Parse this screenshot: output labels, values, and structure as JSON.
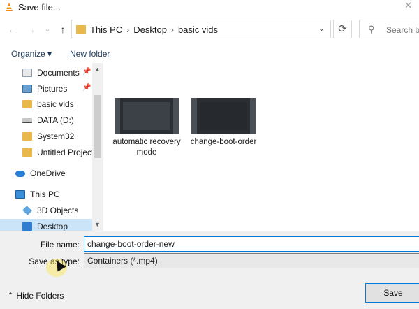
{
  "window": {
    "title": "Save file..."
  },
  "nav": {
    "back": "←",
    "forward": "→",
    "recent": "⌄",
    "up": "↑",
    "refresh": "⟳",
    "dropdown": "⌄"
  },
  "breadcrumb": [
    "This PC",
    "Desktop",
    "basic vids"
  ],
  "search": {
    "placeholder": "Search ba"
  },
  "toolbar": {
    "organize": "Organize ▾",
    "new_folder": "New folder"
  },
  "sidebar": {
    "items": [
      {
        "label": "Documents",
        "icon": "documents-icon",
        "pinned": true
      },
      {
        "label": "Pictures",
        "icon": "pictures-icon",
        "pinned": true
      },
      {
        "label": "basic vids",
        "icon": "folder-icon",
        "pinned": false
      },
      {
        "label": "DATA (D:)",
        "icon": "drive-icon",
        "pinned": false
      },
      {
        "label": "System32",
        "icon": "folder-icon",
        "pinned": false
      },
      {
        "label": "Untitled Project",
        "icon": "folder-icon",
        "pinned": false
      },
      {
        "label": "OneDrive",
        "icon": "cloud-icon",
        "pinned": false
      },
      {
        "label": "This PC",
        "icon": "computer-icon",
        "pinned": false
      },
      {
        "label": "3D Objects",
        "icon": "cube-icon",
        "pinned": false
      },
      {
        "label": "Desktop",
        "icon": "desktop-icon",
        "pinned": false,
        "selected": true
      }
    ]
  },
  "files": [
    {
      "name": "automatic recovery mode",
      "type": "video"
    },
    {
      "name": "change-boot-order",
      "type": "video"
    }
  ],
  "form": {
    "filename_label": "File name:",
    "filename_value": "change-boot-order-new",
    "savetype_label": "Save as type:",
    "savetype_value": "Containers (*.mp4)"
  },
  "footer": {
    "hide_folders": "Hide Folders",
    "save": "Save"
  },
  "colors": {
    "accent": "#0078d7",
    "selection": "#cce4f7",
    "folder": "#e8b84a",
    "panel": "#f0f0f0"
  }
}
